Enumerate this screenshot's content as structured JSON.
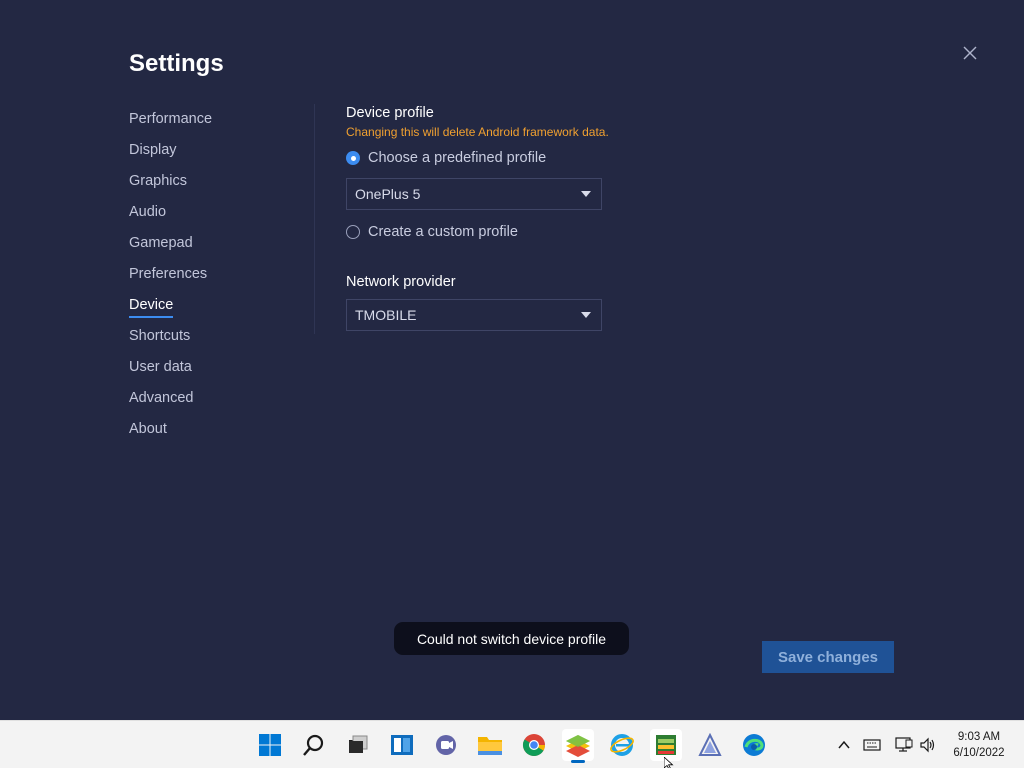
{
  "window": {
    "title": "Settings",
    "close_icon": "close-icon"
  },
  "nav": {
    "items": [
      {
        "label": "Performance",
        "active": false
      },
      {
        "label": "Display",
        "active": false
      },
      {
        "label": "Graphics",
        "active": false
      },
      {
        "label": "Audio",
        "active": false
      },
      {
        "label": "Gamepad",
        "active": false
      },
      {
        "label": "Preferences",
        "active": false
      },
      {
        "label": "Device",
        "active": true
      },
      {
        "label": "Shortcuts",
        "active": false
      },
      {
        "label": "User data",
        "active": false
      },
      {
        "label": "Advanced",
        "active": false
      },
      {
        "label": "About",
        "active": false
      }
    ]
  },
  "device_profile": {
    "title": "Device profile",
    "warning": "Changing this will delete Android framework data.",
    "predefined_label": "Choose a predefined profile",
    "predefined_checked": true,
    "predefined_value": "OnePlus 5",
    "custom_label": "Create a custom profile",
    "custom_checked": false
  },
  "network": {
    "title": "Network provider",
    "value": "TMOBILE"
  },
  "toast": {
    "message": "Could not switch device profile"
  },
  "actions": {
    "save_label": "Save changes"
  },
  "colors": {
    "background": "#232843",
    "accent": "#3c8cf0",
    "warning": "#f0a030",
    "save_button": "#1f5296"
  },
  "taskbar": {
    "apps": [
      "windows-start-icon",
      "search-icon",
      "task-view-icon",
      "widgets-icon",
      "teams-chat-icon",
      "file-explorer-icon",
      "chrome-icon",
      "bluestacks-icon",
      "internet-explorer-icon",
      "archive-app-icon",
      "arch-app-icon",
      "edge-icon"
    ],
    "tray": [
      "chevron-up-icon",
      "keyboard-icon",
      "network-icon",
      "volume-icon"
    ],
    "time": "9:03 AM",
    "date": "6/10/2022"
  }
}
